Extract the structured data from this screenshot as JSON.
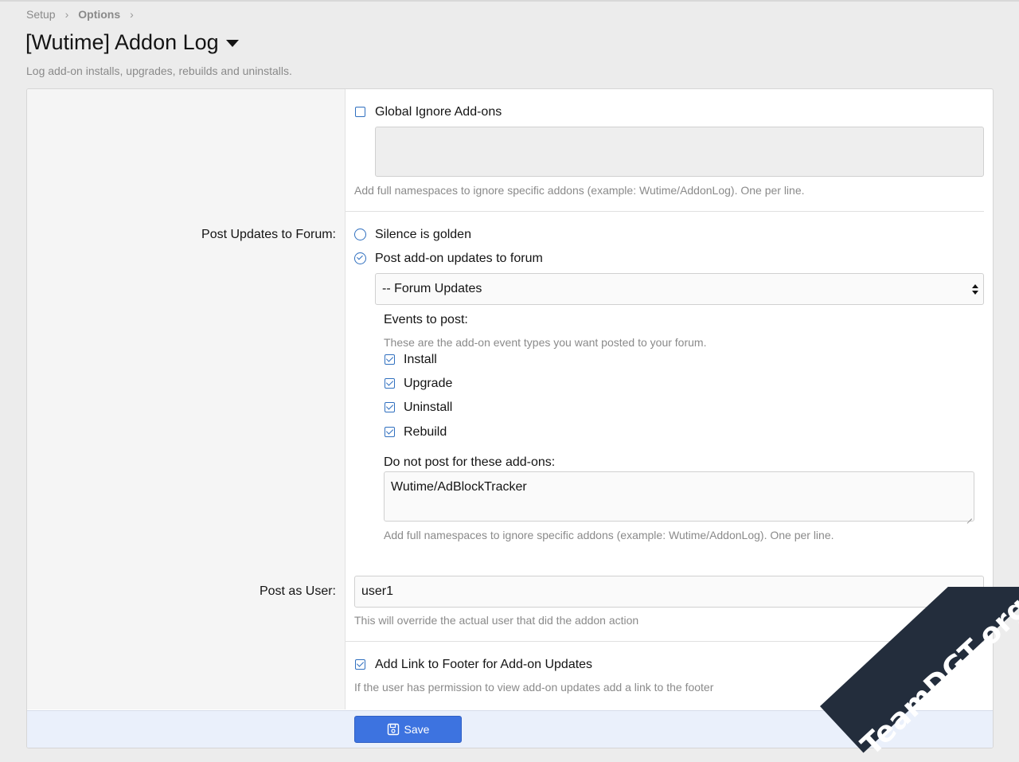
{
  "breadcrumb": {
    "items": [
      "Setup",
      "Options"
    ],
    "separator": "›"
  },
  "page": {
    "title": "[Wutime] Addon Log",
    "description": "Log add-on installs, upgrades, rebuilds and uninstalls."
  },
  "options": {
    "global_ignore": {
      "label": "Global Ignore Add-ons",
      "checked": false,
      "textarea_value": "",
      "hint": "Add full namespaces to ignore specific addons (example: Wutime/AddonLog). One per line."
    },
    "post_updates": {
      "label": "Post Updates to Forum:",
      "radio_silence": "Silence is golden",
      "radio_post": "Post add-on updates to forum",
      "selected": "post",
      "forum_select": "-- Forum Updates",
      "events_heading": "Events to post:",
      "events_hint": "These are the add-on event types you want posted to your forum.",
      "events": [
        {
          "label": "Install",
          "checked": true
        },
        {
          "label": "Upgrade",
          "checked": true
        },
        {
          "label": "Uninstall",
          "checked": true
        },
        {
          "label": "Rebuild",
          "checked": true
        }
      ],
      "ignore_heading": "Do not post for these add-ons:",
      "ignore_value": "Wutime/AdBlockTracker",
      "ignore_hint": "Add full namespaces to ignore specific addons (example: Wutime/AddonLog). One per line."
    },
    "post_as_user": {
      "label": "Post as User:",
      "value": "user1",
      "hint": "This will override the actual user that did the addon action"
    },
    "footer_link": {
      "label": "Add Link to Footer for Add-on Updates",
      "checked": true,
      "hint": "If the user has permission to view add-on updates add a link to the footer"
    }
  },
  "actions": {
    "save_label": "Save"
  },
  "watermark": "TeamDGT.org",
  "colors": {
    "accent": "#2f6fbf",
    "button": "#3d73e0",
    "footer_bg": "#eaf0fb"
  }
}
